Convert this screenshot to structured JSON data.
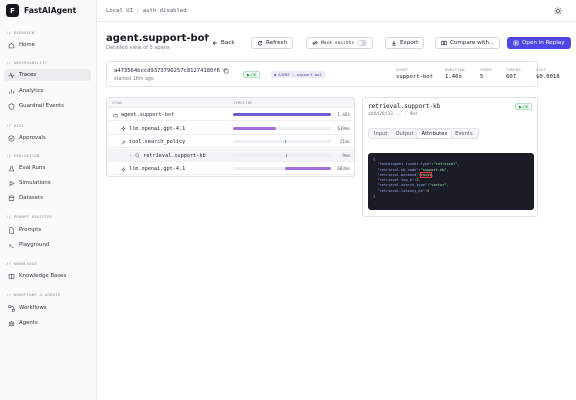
{
  "app": {
    "name": "FastAIAgent",
    "logo_letter": "F"
  },
  "topbar": {
    "crumb1": "Local UI",
    "sep": "/",
    "crumb2": "auth disabled"
  },
  "sidebar": {
    "sections": [
      {
        "label": "// OVERVIEW",
        "items": [
          {
            "label": "Home",
            "icon": "home-icon"
          }
        ]
      },
      {
        "label": "// OBSERVABILITY",
        "items": [
          {
            "label": "Traces",
            "icon": "activity-icon",
            "active": true
          },
          {
            "label": "Analytics",
            "icon": "chart-icon"
          },
          {
            "label": "Guardrail Events",
            "icon": "shield-icon"
          }
        ]
      },
      {
        "label": "// HITL",
        "items": [
          {
            "label": "Approvals",
            "icon": "check-circle-icon"
          }
        ]
      },
      {
        "label": "// EVALUATION",
        "items": [
          {
            "label": "Eval Runs",
            "icon": "flask-icon"
          },
          {
            "label": "Simulations",
            "icon": "play-icon"
          },
          {
            "label": "Datasets",
            "icon": "database-icon"
          }
        ]
      },
      {
        "label": "// PROMPT REGISTRY",
        "items": [
          {
            "label": "Prompts",
            "icon": "file-icon"
          },
          {
            "label": "Playground",
            "icon": "terminal-icon"
          }
        ]
      },
      {
        "label": "// KNOWLEDGE",
        "items": [
          {
            "label": "Knowledge Bases",
            "icon": "book-icon"
          }
        ]
      },
      {
        "label": "// WORKFLOWS & AGENTS",
        "items": [
          {
            "label": "Workflows",
            "icon": "workflow-icon"
          },
          {
            "label": "Agents",
            "icon": "bot-icon"
          }
        ]
      }
    ]
  },
  "header": {
    "title": "agent.support-bot",
    "subtitle": "Detailed view of 5 spans",
    "back": "Back",
    "refresh": "Refresh",
    "mask": "Mask secrets",
    "export": "Export",
    "compare": "Compare with...",
    "replay": "Open in Replay"
  },
  "summary": {
    "trace_id": "a473564bccd9373796257c81274180f6",
    "started": "started 16m ago",
    "status": "OK",
    "tag": "AGENT : support-bot",
    "stats": [
      {
        "label": "AGENT",
        "value": "support-bot"
      },
      {
        "label": "DURATION",
        "value": "1.46s"
      },
      {
        "label": "SPANS",
        "value": "5"
      },
      {
        "label": "TOKENS",
        "value": "607"
      },
      {
        "label": "COST",
        "value": "$0.0018"
      }
    ]
  },
  "spans": {
    "col_span": "SPAN",
    "col_timeline": "TIMELINE",
    "rows": [
      {
        "name": "agent.support-bot",
        "duration": "1.46s",
        "start": 0.0,
        "length": 1.0,
        "color": "#6d5fd6",
        "depth": 0,
        "icon": "bot-icon"
      },
      {
        "name": "llm.openai.gpt-4.1",
        "duration": "639ms",
        "start": 0.0,
        "length": 0.44,
        "color": "#a86ee0",
        "depth": 1,
        "icon": "sparkle-icon"
      },
      {
        "name": "tool.search_policy",
        "duration": "21ms",
        "start": 0.53,
        "length": 0.015,
        "color": "#5aa3a8",
        "depth": 1,
        "icon": "wrench-icon"
      },
      {
        "name": "retrieval.support-kb",
        "duration": "9ms",
        "start": 0.54,
        "length": 0.008,
        "color": "#8b8f99",
        "depth": 2,
        "icon": "search-icon",
        "selected": true
      },
      {
        "name": "llm.openai.gpt-4.1",
        "duration": "683ms",
        "start": 0.53,
        "length": 0.47,
        "color": "#a86ee0",
        "depth": 1,
        "icon": "sparkle-icon"
      }
    ]
  },
  "detail": {
    "title": "retrieval.support-kb",
    "status": "OK",
    "subtitle": "ad9d28f33... · 9ms",
    "tabs": [
      "Input",
      "Output",
      "Attributes",
      "Events"
    ],
    "active_tab": "Attributes",
    "code": {
      "open": "{",
      "l1k": "\"fastaiagent.runner.type\"",
      "l1v": "\"retrieval\"",
      "l2k": "\"retrieval.kb_name\"",
      "l2v": "\"support-kb\"",
      "l3k": "\"retrieval.backend\"",
      "l3v": "faiss",
      "l4k": "\"retrieval.top_k\"",
      "l4v": "3",
      "l5k": "\"retrieval.search_type\"",
      "l5v": "\"vector\"",
      "l6k": "\"retrieval.latency_ms\"",
      "l6v": "9",
      "close": "}"
    }
  },
  "colors": {
    "accent": "#4f46e5",
    "ok": "#1f8a4c",
    "code_bg": "#1b1d26",
    "highlight": "#e53935"
  }
}
